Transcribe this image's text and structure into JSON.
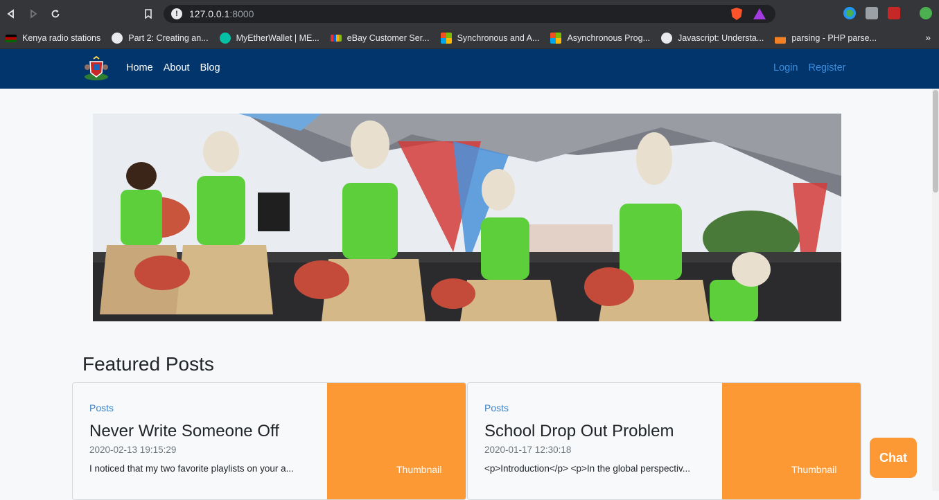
{
  "browser": {
    "url_host": "127.0.0.1",
    "url_port": ":8000",
    "bookmarks": [
      {
        "label": "Kenya radio stations",
        "icon": "kenya-flag-icon",
        "color": "#bb0000"
      },
      {
        "label": "Part 2: Creating an...",
        "icon": "globe-icon",
        "color": "#e8eaed"
      },
      {
        "label": "MyEtherWallet | ME...",
        "icon": "myetherwallet-icon",
        "color": "#05c0a5"
      },
      {
        "label": "eBay Customer Ser...",
        "icon": "ebay-icon",
        "color": "#e53238"
      },
      {
        "label": "Synchronous and A...",
        "icon": "microsoft-icon",
        "color": "#f25022"
      },
      {
        "label": "Asynchronous Prog...",
        "icon": "microsoft-icon",
        "color": "#f25022"
      },
      {
        "label": "Javascript: Understa...",
        "icon": "globe-icon",
        "color": "#e8eaed"
      },
      {
        "label": "parsing - PHP parse...",
        "icon": "stackoverflow-icon",
        "color": "#f48024"
      }
    ],
    "more_bookmarks": "»"
  },
  "site": {
    "nav": [
      "Home",
      "About",
      "Blog"
    ],
    "auth": [
      "Login",
      "Register"
    ],
    "featured_title": "Featured Posts",
    "posts": [
      {
        "category": "Posts",
        "title": "Never Write Someone Off",
        "date": "2020-02-13 19:15:29",
        "excerpt": "I noticed that my two favorite playlists on your a...",
        "thumb_label": "Thumbnail"
      },
      {
        "category": "Posts",
        "title": "School Drop Out Problem",
        "date": "2020-01-17 12:30:18",
        "excerpt": "<p>Introduction</p> <p>In the global perspectiv...",
        "thumb_label": "Thumbnail"
      }
    ],
    "chat_label": "Chat"
  },
  "colors": {
    "navbar": "#01356b",
    "accent": "#fd9935",
    "link": "#3b8de0"
  }
}
